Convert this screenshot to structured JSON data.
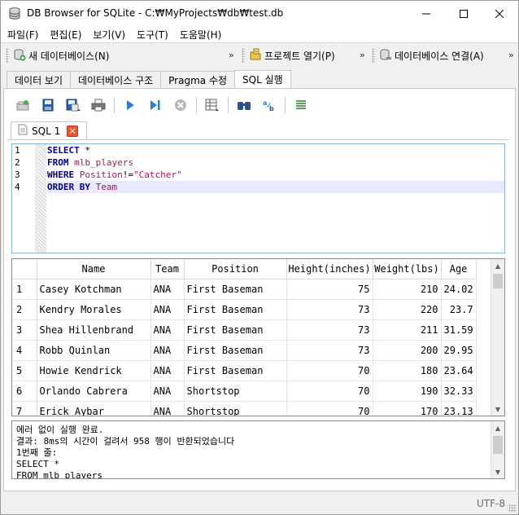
{
  "window": {
    "title": "DB Browser for SQLite - C:₩MyProjects₩db₩test.db",
    "minimize_icon": "minimize-icon",
    "maximize_icon": "maximize-icon",
    "close_icon": "close-icon"
  },
  "menu": [
    {
      "label": "파일(F)"
    },
    {
      "label": "편집(E)"
    },
    {
      "label": "보기(V)"
    },
    {
      "label": "도구(T)"
    },
    {
      "label": "도움말(H)"
    }
  ],
  "toolbar": {
    "new_db": "새 데이터베이스(N)",
    "open_project": "프로젝트 열기(P)",
    "db_connect": "데이터베이스 연결(A)",
    "overflow": "»"
  },
  "tabs": [
    {
      "label": "데이터 보기"
    },
    {
      "label": "데이터베이스 구조"
    },
    {
      "label": "Pragma 수정"
    },
    {
      "label": "SQL 실행"
    }
  ],
  "active_tab": 3,
  "sql_editor": {
    "tab_label": "SQL 1",
    "lines": [
      {
        "num": "1"
      },
      {
        "num": "2"
      },
      {
        "num": "3"
      },
      {
        "num": "4"
      }
    ],
    "code": {
      "l1_kw": "SELECT",
      "l1_rest": " *",
      "l2_kw": "FROM",
      "l2_id": " mlb_players",
      "l3_kw": "WHERE",
      "l3_id": " Position",
      "l3_op": "!=",
      "l3_str": "\"Catcher\"",
      "l4_kw": "ORDER BY",
      "l4_id": " Team"
    }
  },
  "results": {
    "columns": [
      "Name",
      "Team",
      "Position",
      "Height(inches)",
      "Weight(lbs)",
      "Age"
    ],
    "rows": [
      {
        "n": "1",
        "name": "Casey Kotchman",
        "team": "ANA",
        "pos": "First Baseman",
        "height": "75",
        "weight": "210",
        "age": "24.02"
      },
      {
        "n": "2",
        "name": "Kendry Morales",
        "team": "ANA",
        "pos": "First Baseman",
        "height": "73",
        "weight": "220",
        "age": "23.7"
      },
      {
        "n": "3",
        "name": "Shea Hillenbrand",
        "team": "ANA",
        "pos": "First Baseman",
        "height": "73",
        "weight": "211",
        "age": "31.59"
      },
      {
        "n": "4",
        "name": "Robb Quinlan",
        "team": "ANA",
        "pos": "First Baseman",
        "height": "73",
        "weight": "200",
        "age": "29.95"
      },
      {
        "n": "5",
        "name": "Howie Kendrick",
        "team": "ANA",
        "pos": "First Baseman",
        "height": "70",
        "weight": "180",
        "age": "23.64"
      },
      {
        "n": "6",
        "name": "Orlando Cabrera",
        "team": "ANA",
        "pos": "Shortstop",
        "height": "70",
        "weight": "190",
        "age": "32.33"
      },
      {
        "n": "7",
        "name": "Erick Aybar",
        "team": "ANA",
        "pos": "Shortstop",
        "height": "70",
        "weight": "170",
        "age": "23.13"
      }
    ]
  },
  "messages": {
    "line1": "에러 없이 실행 완료.",
    "line2": "결과: 8ms의 시간이 걸려서 958 행이 반환되었습니다",
    "line3": "1번째 줄:",
    "line4": "SELECT *",
    "line5": "FROM mlb_players"
  },
  "status": {
    "encoding": "UTF-8"
  },
  "colors": {
    "keyword": "#00008b",
    "identifier": "#8b2252",
    "string": "#a0174a",
    "current_line": "#e8e8ff",
    "tab_close": "#e05a3a"
  }
}
